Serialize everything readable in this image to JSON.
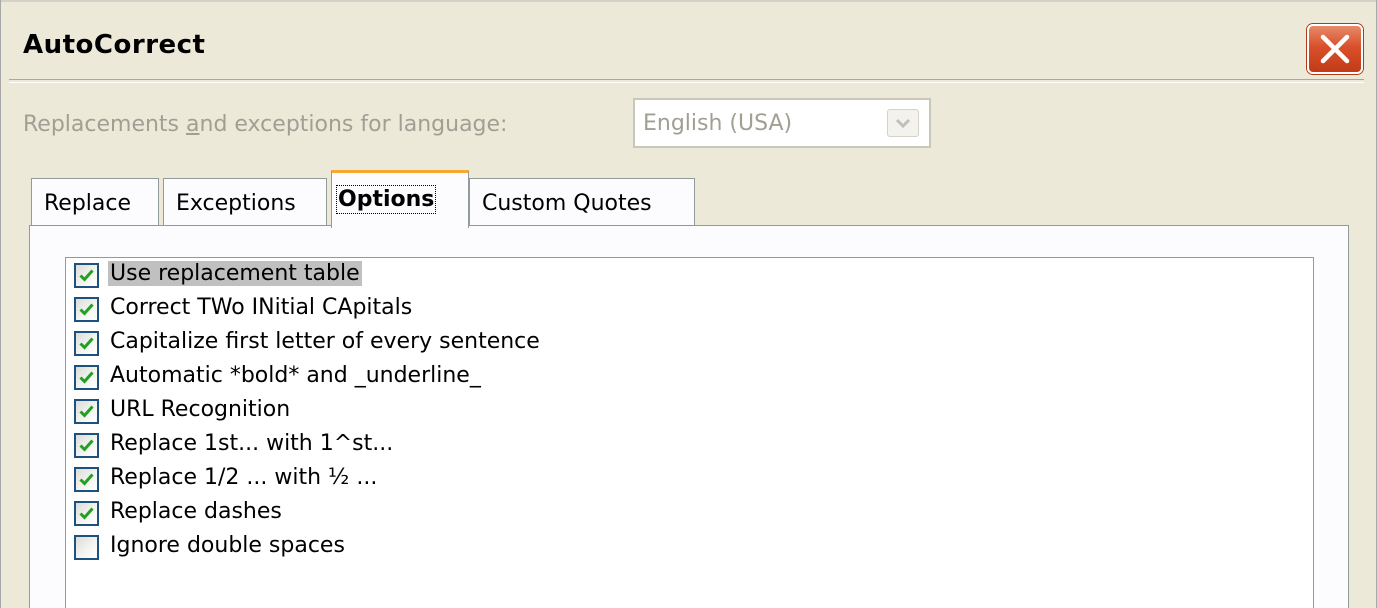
{
  "window": {
    "title": "AutoCorrect"
  },
  "language": {
    "label_pre": "Replacements ",
    "label_accel": "a",
    "label_post": "nd exceptions for language:",
    "value": "English (USA)"
  },
  "tabs": [
    {
      "label": "Replace",
      "active": false
    },
    {
      "label": "Exceptions",
      "active": false
    },
    {
      "label": "Options",
      "active": true
    },
    {
      "label": "Custom Quotes",
      "active": false
    }
  ],
  "options": [
    {
      "label": "Use replacement table",
      "checked": true,
      "selected": true
    },
    {
      "label": "Correct TWo INitial CApitals",
      "checked": true,
      "selected": false
    },
    {
      "label": "Capitalize first letter of every sentence",
      "checked": true,
      "selected": false
    },
    {
      "label": "Automatic *bold* and _underline_",
      "checked": true,
      "selected": false
    },
    {
      "label": "URL Recognition",
      "checked": true,
      "selected": false
    },
    {
      "label": "Replace 1st... with 1^st...",
      "checked": true,
      "selected": false
    },
    {
      "label": "Replace 1/2 ... with ½ ...",
      "checked": true,
      "selected": false
    },
    {
      "label": "Replace dashes",
      "checked": true,
      "selected": false
    },
    {
      "label": "Ignore double spaces",
      "checked": false,
      "selected": false
    }
  ],
  "colors": {
    "checkmark": "#21a121",
    "active_tab_accent": "#f6a832",
    "close_button": "#d9502b"
  }
}
